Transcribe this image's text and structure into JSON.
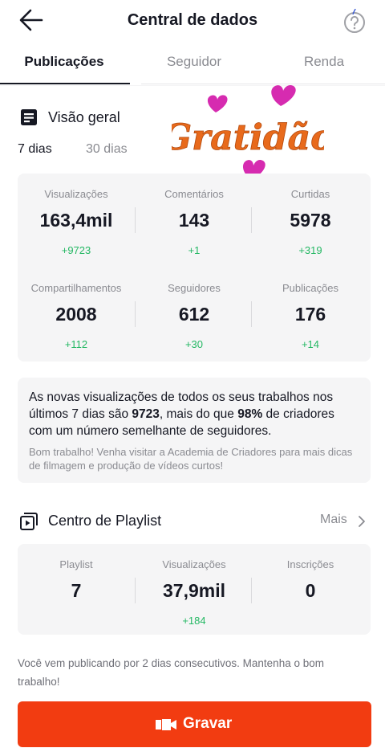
{
  "header": {
    "title": "Central de dados",
    "back_icon": "arrow-left-icon",
    "help_icon": "question-circle-icon"
  },
  "tabs": [
    {
      "label": "Publicações"
    },
    {
      "label": "Seguidor"
    },
    {
      "label": "Renda"
    }
  ],
  "overview": {
    "title": "Visão geral",
    "ranges": [
      "7 dias",
      "30 dias"
    ],
    "sticker_text": "Gratidão",
    "stats": [
      {
        "label": "Visualizações",
        "value": "163,4mil",
        "delta": "+9723"
      },
      {
        "label": "Comentários",
        "value": "143",
        "delta": "+1"
      },
      {
        "label": "Curtidas",
        "value": "5978",
        "delta": "+319"
      },
      {
        "label": "Compartilhamentos",
        "value": "2008",
        "delta": "+112"
      },
      {
        "label": "Seguidores",
        "value": "612",
        "delta": "+30"
      },
      {
        "label": "Publicações",
        "value": "176",
        "delta": "+14"
      }
    ]
  },
  "insight": {
    "part1": "As novas visualizações de todos os seus trabalhos nos últimos 7 dias são ",
    "views": "9723",
    "part2": ", mais do que ",
    "percent": "98%",
    "part3": " de criadores com um número semelhante de seguidores.",
    "sub": "Bom trabalho! Venha visitar a Academia de Criadores para mais dicas de filmagem e produção de vídeos curtos!"
  },
  "playlist": {
    "title": "Centro de Playlist",
    "more": "Mais",
    "stats": [
      {
        "label": "Playlist",
        "value": "7",
        "delta": ""
      },
      {
        "label": "Visualizações",
        "value": "37,9mil",
        "delta": "+184"
      },
      {
        "label": "Inscrições",
        "value": "0",
        "delta": ""
      }
    ]
  },
  "footer": {
    "streak": "Você vem publicando por 2 dias consecutivos. Mantenha o bom trabalho!",
    "record_label": "Gravar"
  },
  "colors": {
    "accent": "#f23c11",
    "positive": "#25b864",
    "muted": "#8a8b91",
    "sticker": "#e86a1c",
    "heart": "#d62bb0"
  }
}
